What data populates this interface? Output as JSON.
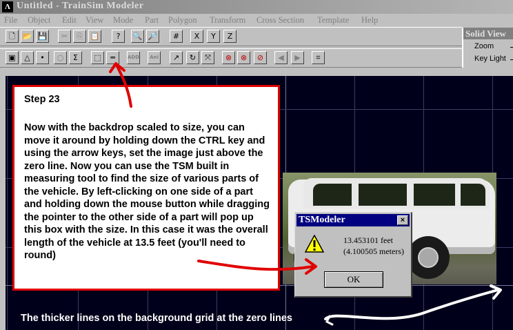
{
  "window": {
    "title": "Untitled - TrainSim Modeler"
  },
  "menu": [
    "File",
    "Object",
    "Edit",
    "View",
    "Mode",
    "Part",
    "Polygon",
    "Transform",
    "Cross Section",
    "Template",
    "Help"
  ],
  "toolbar_top": [
    {
      "name": "new-file-icon",
      "glyph": "🗋"
    },
    {
      "name": "open-folder-icon",
      "glyph": "📂"
    },
    {
      "name": "save-disk-icon",
      "glyph": "💾"
    },
    {
      "name": "cut-icon",
      "glyph": "✂"
    },
    {
      "name": "copy-icon",
      "glyph": "⎘"
    },
    {
      "name": "paste-icon",
      "glyph": "📋"
    },
    {
      "name": "help-icon",
      "glyph": "?"
    },
    {
      "name": "zoom-in-icon",
      "glyph": "🔍"
    },
    {
      "name": "zoom-out-icon",
      "glyph": "🔎"
    },
    {
      "name": "grid-icon",
      "glyph": "#"
    },
    {
      "name": "view-x-icon",
      "glyph": "X"
    },
    {
      "name": "view-y-icon",
      "glyph": "Y"
    },
    {
      "name": "view-z-icon",
      "glyph": "Z"
    }
  ],
  "toolbar_bottom": [
    {
      "name": "select-part-icon",
      "glyph": "▣"
    },
    {
      "name": "triangle-tool-icon",
      "glyph": "△"
    },
    {
      "name": "point-tool-icon",
      "glyph": "•"
    },
    {
      "name": "circle-tool-icon",
      "glyph": "○"
    },
    {
      "name": "sum-tool-icon",
      "glyph": "Σ"
    },
    {
      "name": "select-region-icon",
      "glyph": "⬚"
    },
    {
      "name": "measure-tool-icon",
      "glyph": "═"
    },
    {
      "name": "add-part-icon",
      "glyph": "ADD"
    },
    {
      "name": "animate-icon",
      "glyph": "Ani"
    },
    {
      "name": "move-arrow-icon",
      "glyph": "↗"
    },
    {
      "name": "rotate-icon",
      "glyph": "↻"
    },
    {
      "name": "scale-icon",
      "glyph": "⤧"
    },
    {
      "name": "delete-x-icon",
      "glyph": "⊗"
    },
    {
      "name": "delete-y-icon",
      "glyph": "⊗"
    },
    {
      "name": "delete-z-icon",
      "glyph": "⊘"
    },
    {
      "name": "previous-icon",
      "glyph": "◀"
    },
    {
      "name": "next-icon",
      "glyph": "▶"
    },
    {
      "name": "binoculars-icon",
      "glyph": "⌗"
    }
  ],
  "solid_view": {
    "title": "Solid View",
    "zoom_label": "Zoom",
    "key_light_label": "Key Light"
  },
  "instruction": {
    "step": "Step 23",
    "body": "Now with the backdrop scaled to size, you can move it around by holding down the CTRL key and using the arrow keys, set the image just above the zero line. Now you can use the TSM built in measuring tool to find the size of various parts of the vehicle. By left-clicking on one side of a part and holding down the mouse button while dragging the pointer to the other side of a part will pop up this box with the size. In this case it was the overall length of the vehicle at 13.5 feet (you'll need to round)"
  },
  "dialog": {
    "title": "TSModeler",
    "close": "×",
    "line1": "13.453101 feet",
    "line2": "(4.100505 meters)",
    "ok": "OK"
  },
  "caption": "The thicker lines on the background grid at the zero lines",
  "colors": {
    "annotation_red": "#e00000",
    "dialog_title": "#000080",
    "viewport_bg": "#00001a"
  }
}
